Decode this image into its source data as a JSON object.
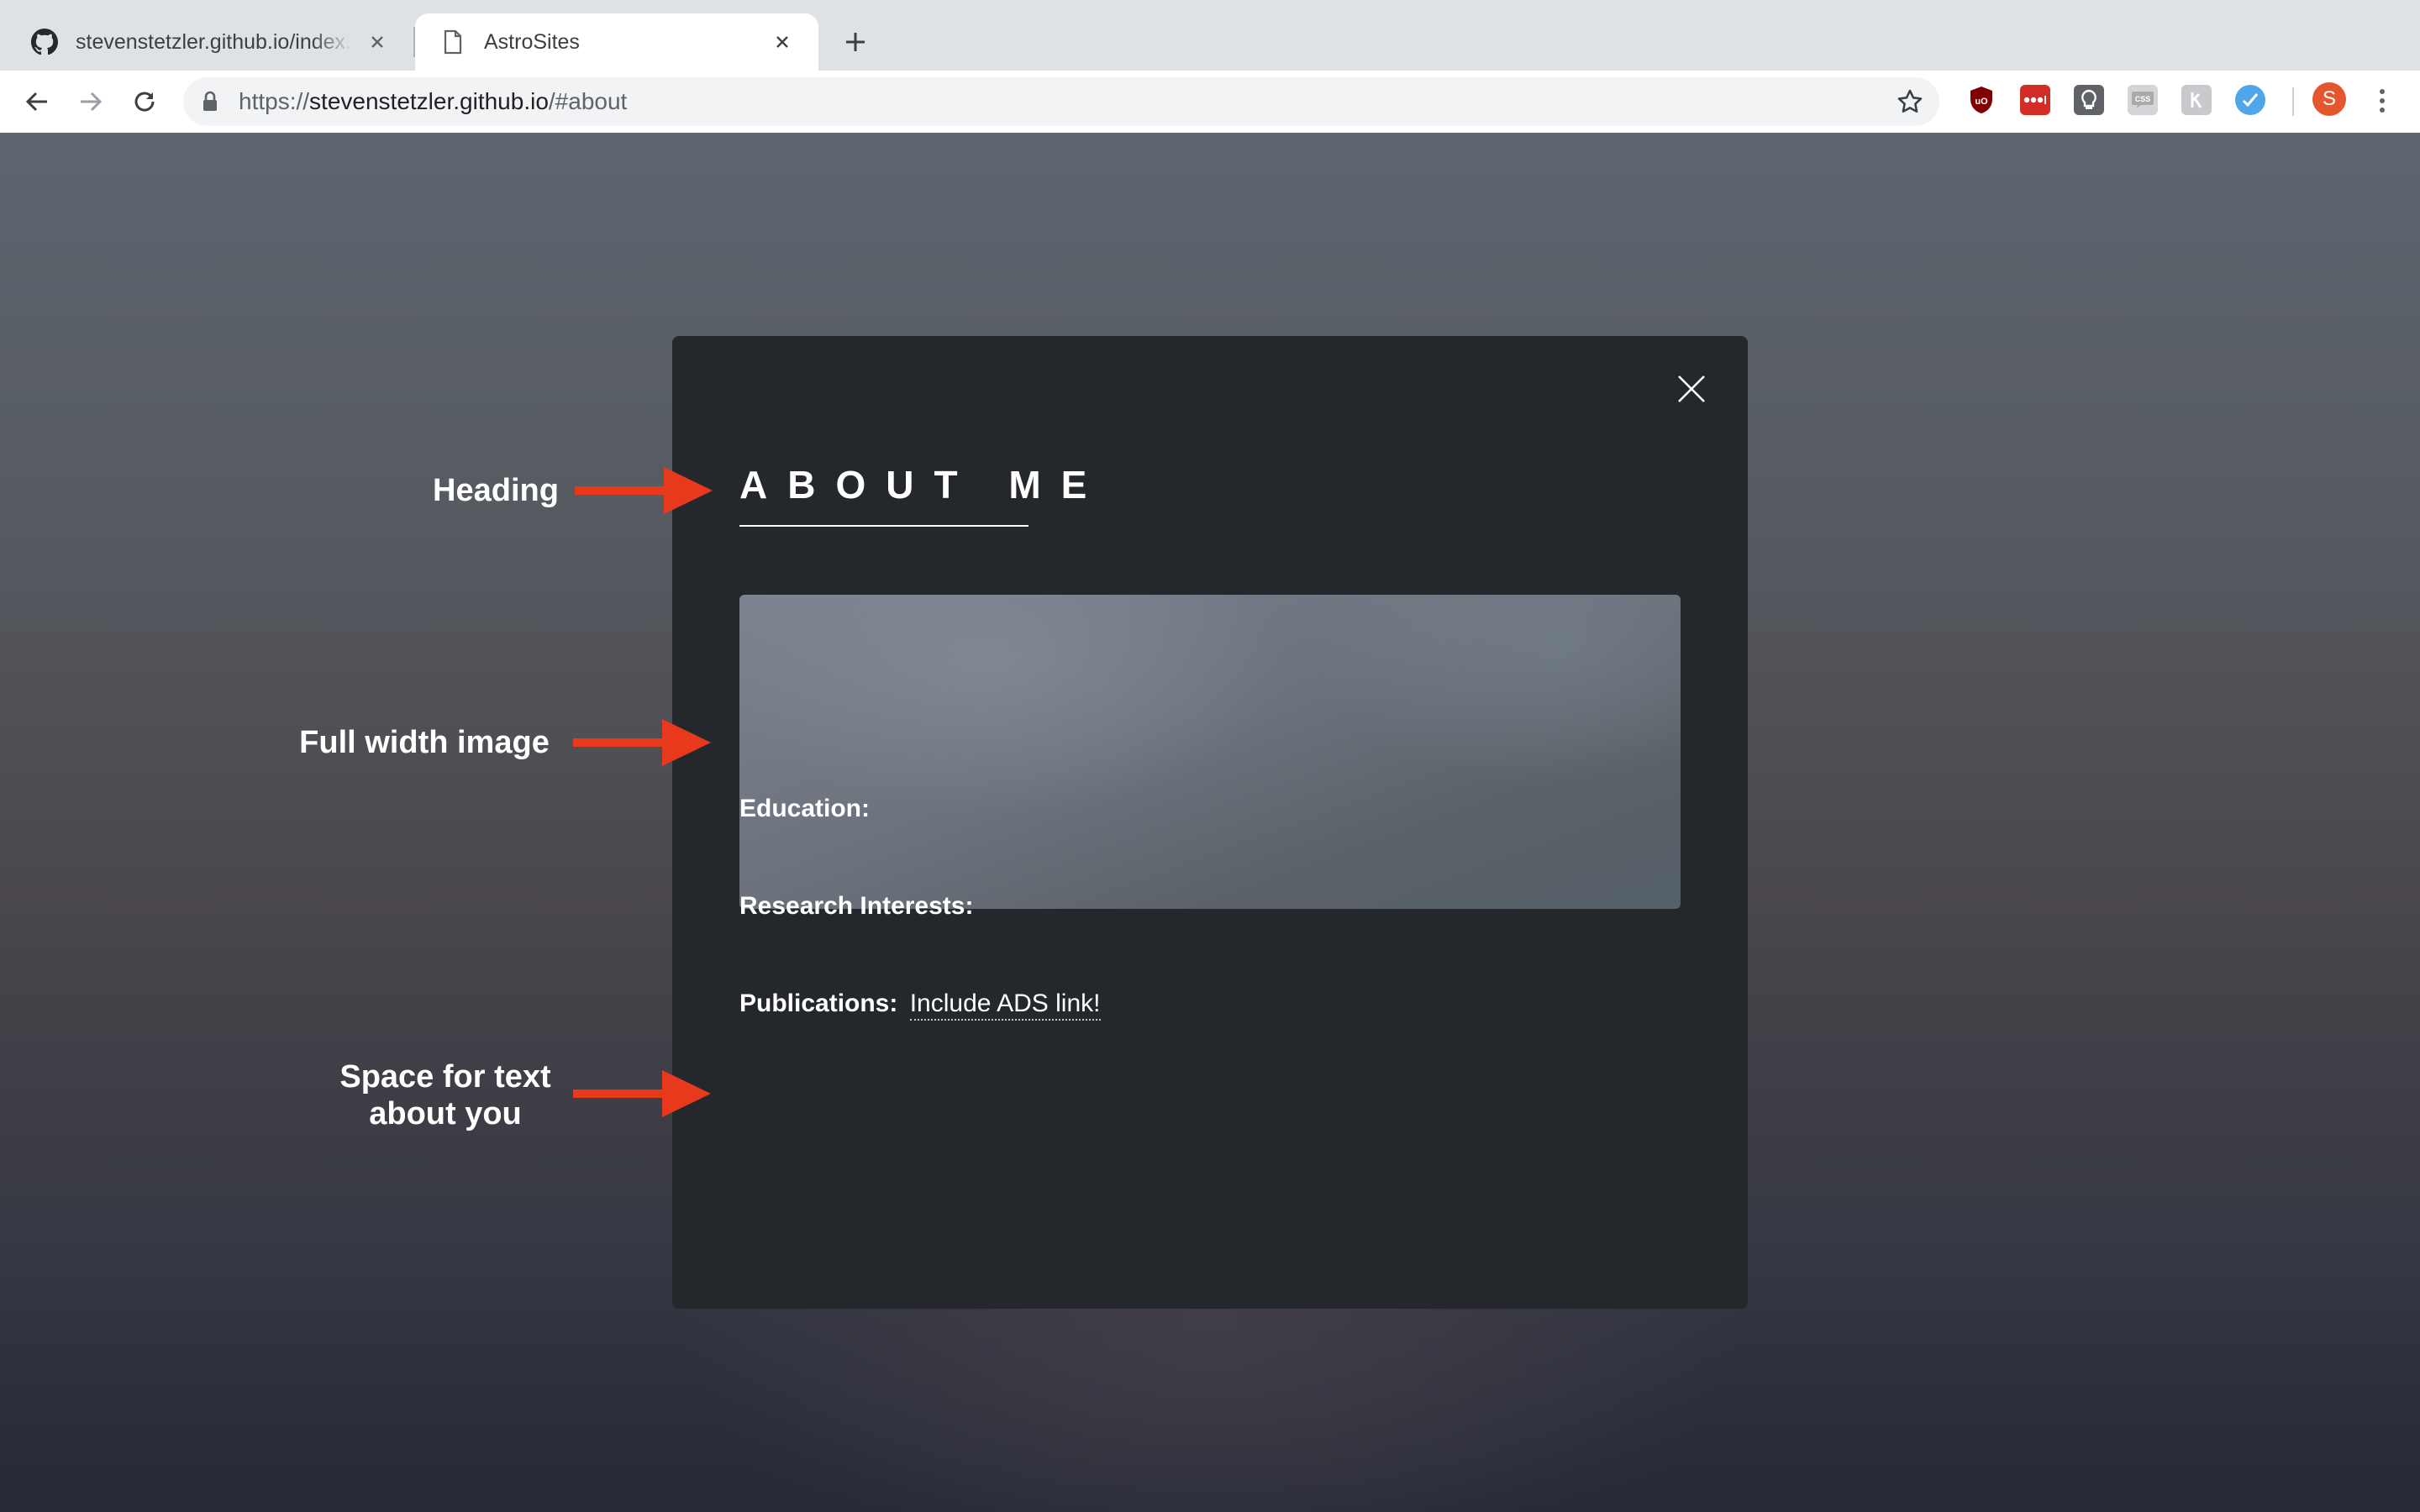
{
  "browser": {
    "tabs": [
      {
        "title": "stevenstetzler.github.io/index.h",
        "icon": "github-icon",
        "active": false
      },
      {
        "title": "AstroSites",
        "icon": "page-icon",
        "active": true
      }
    ],
    "url": {
      "scheme": "https://",
      "host": "stevenstetzler.github.io",
      "path": "/#about"
    },
    "profile_initial": "S"
  },
  "modal": {
    "heading": "ABOUT ME",
    "education_label": "Education:",
    "research_label": "Research Interests:",
    "publications_label": "Publications:",
    "publications_link": "Include ADS link!"
  },
  "annotations": {
    "heading": "Heading",
    "image": "Full width image",
    "text_line1": "Space for text",
    "text_line2": "about you"
  },
  "colors": {
    "arrow": "#e8391d",
    "modal_bg": "#24272b",
    "profile": "#e4572e"
  }
}
